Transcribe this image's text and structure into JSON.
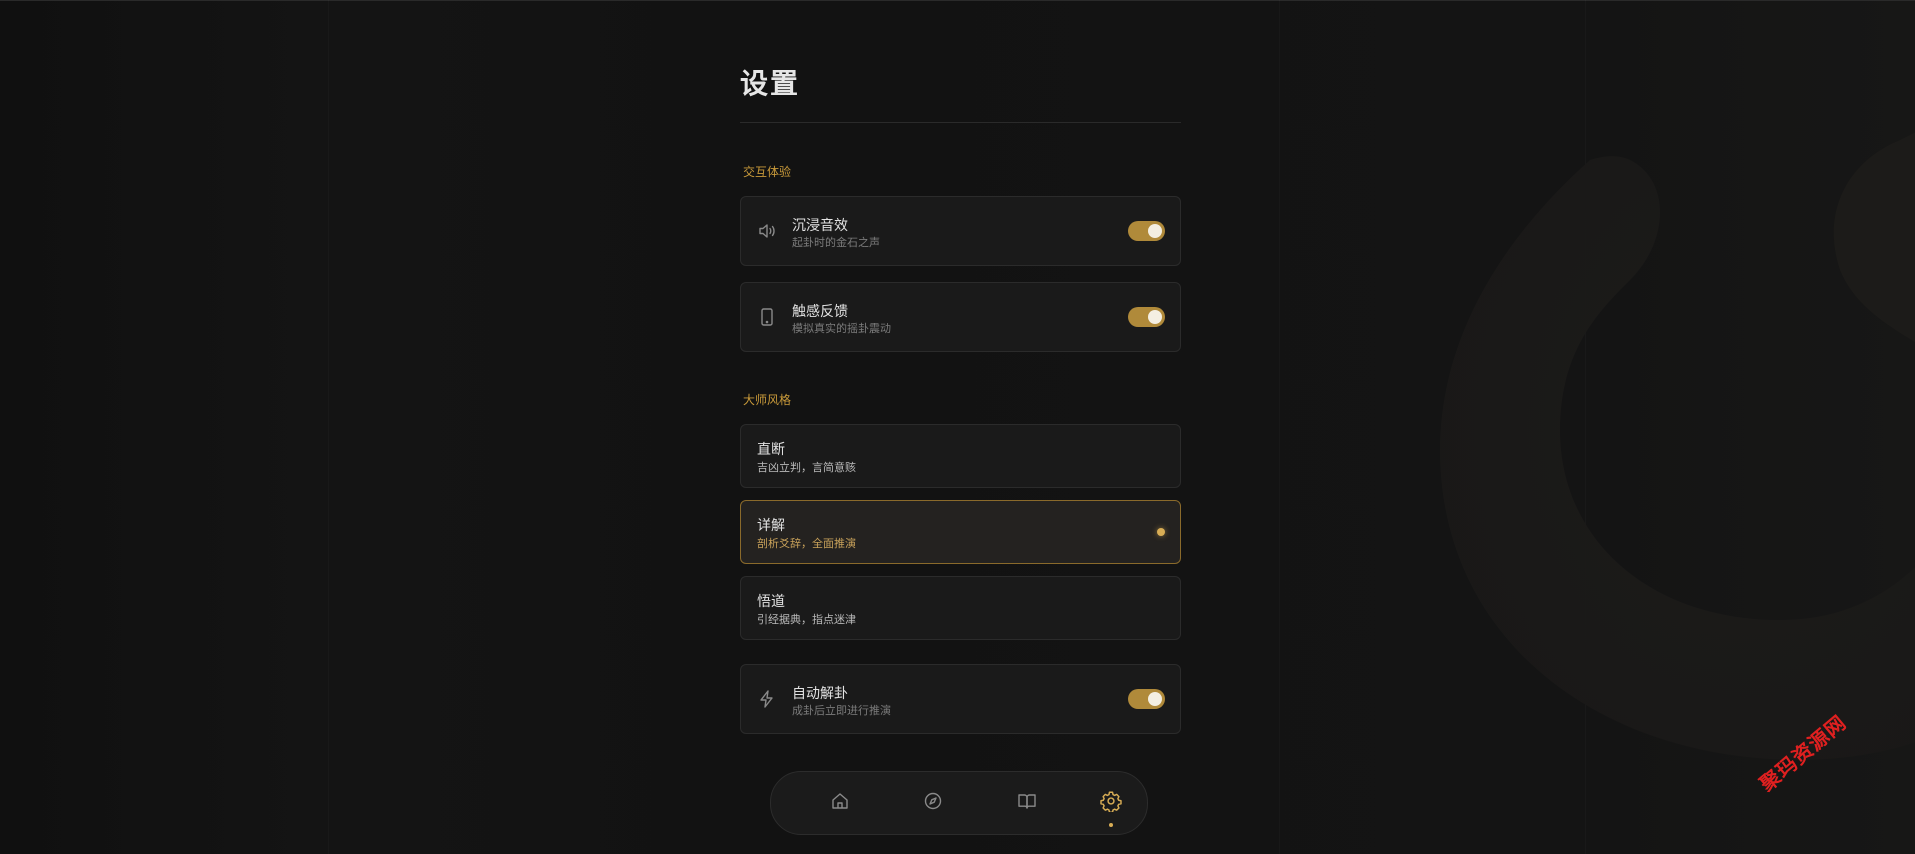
{
  "page": {
    "title": "设置"
  },
  "sections": {
    "interaction": {
      "label": "交互体验",
      "items": [
        {
          "label": "沉浸音效",
          "sub": "起卦时的金石之声",
          "icon": "speaker-icon",
          "enabled": true
        },
        {
          "label": "触感反馈",
          "sub": "模拟真实的摇卦震动",
          "icon": "phone-icon",
          "enabled": true
        }
      ]
    },
    "master_style": {
      "label": "大师风格",
      "options": [
        {
          "label": "直断",
          "sub": "吉凶立判，言简意赅",
          "selected": false
        },
        {
          "label": "详解",
          "sub": "剖析爻辞，全面推演",
          "selected": true
        },
        {
          "label": "悟道",
          "sub": "引经据典，指点迷津",
          "selected": false
        }
      ]
    },
    "auto": {
      "label": "自动解卦",
      "sub": "成卦后立即进行推演",
      "icon": "lightning-icon",
      "enabled": true
    }
  },
  "nav": {
    "items": [
      {
        "icon": "home-icon",
        "active": false
      },
      {
        "icon": "compass-icon",
        "active": false
      },
      {
        "icon": "book-icon",
        "active": false
      },
      {
        "icon": "gear-icon",
        "active": true
      }
    ]
  },
  "watermark": "聚玛资源网",
  "colors": {
    "accent": "#b08a3a",
    "accent_light": "#d8ad55",
    "background": "#131313",
    "card": "#1a1a1a"
  }
}
